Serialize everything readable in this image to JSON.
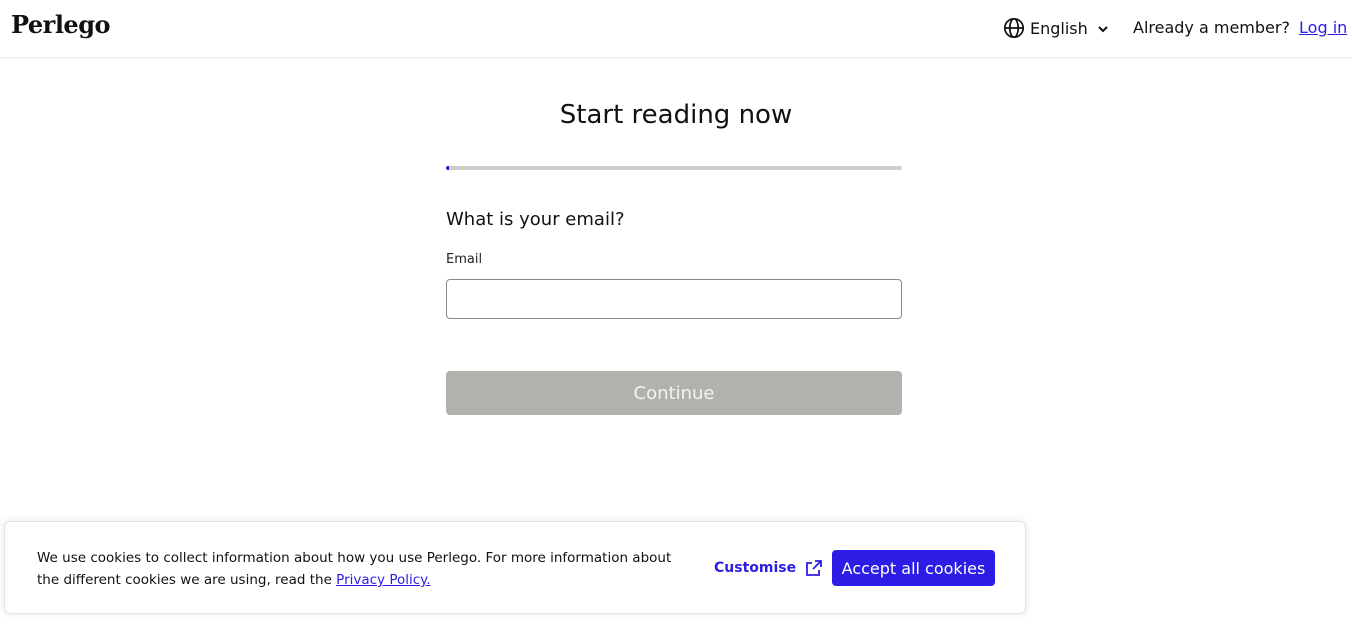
{
  "header": {
    "logo": "Perlego",
    "language": "English",
    "language_icon": "globe-icon",
    "member_prompt": "Already a member?",
    "login_label": "Log in"
  },
  "main": {
    "title": "Start reading now",
    "progress": 0.005,
    "question": "What is your email?",
    "email_label": "Email",
    "email_value": "",
    "email_placeholder": "",
    "continue_label": "Continue"
  },
  "cookie_banner": {
    "text": "We use cookies to collect information about how you use Perlego. For more information about the different cookies we are using, read the ",
    "policy_link": "Privacy Policy.",
    "customise_label": "Customise",
    "customise_icon": "external-link-icon",
    "accept_label": "Accept all cookies"
  },
  "colors": {
    "accent": "#2c1ce6",
    "disabled_button": "#b3b1ae",
    "progress_track": "#cfcdca"
  }
}
